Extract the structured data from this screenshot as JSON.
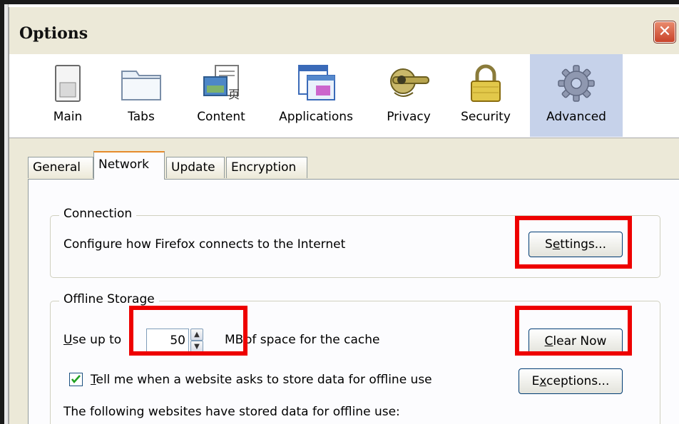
{
  "window": {
    "title": "Options",
    "close_glyph": "✕"
  },
  "toolbar": {
    "panes": [
      {
        "label": "Main",
        "icon": "main-switch-icon"
      },
      {
        "label": "Tabs",
        "icon": "tabs-icon"
      },
      {
        "label": "Content",
        "icon": "content-icon"
      },
      {
        "label": "Applications",
        "icon": "applications-icon"
      },
      {
        "label": "Privacy",
        "icon": "privacy-mask-icon"
      },
      {
        "label": "Security",
        "icon": "security-lock-icon"
      },
      {
        "label": "Advanced",
        "icon": "advanced-gear-icon",
        "selected": true
      }
    ]
  },
  "tabs": [
    {
      "label": "General"
    },
    {
      "label": "Network",
      "active": true
    },
    {
      "label": "Update"
    },
    {
      "label": "Encryption"
    }
  ],
  "connection": {
    "title": "Connection",
    "description": "Configure how Firefox connects to the Internet",
    "settings_button": {
      "accel": "e",
      "before": "S",
      "after": "ttings..."
    }
  },
  "offline_storage": {
    "title": "Offline Storage",
    "use_up_to": {
      "accel": "U",
      "rest": "se up to"
    },
    "cache_value": "50",
    "cache_unit": "MB",
    "cache_suffix": "of space for the cache",
    "clear_now_button": {
      "accel": "C",
      "rest": "lear Now"
    },
    "tell_me": {
      "checked": true,
      "accel": "T",
      "rest": "ell me when a website asks to store data for offline use"
    },
    "exceptions_button": {
      "before": "E",
      "accel": "x",
      "after": "ceptions..."
    },
    "stored_data_label": "The following websites have stored data for offline use:"
  },
  "colors": {
    "highlight": "#ee0000",
    "selected_pane": "#c6d2ea",
    "active_tab_accent": "#e68b2c",
    "dialog_bg": "#ece9d8",
    "close_button": "#c8432a"
  }
}
